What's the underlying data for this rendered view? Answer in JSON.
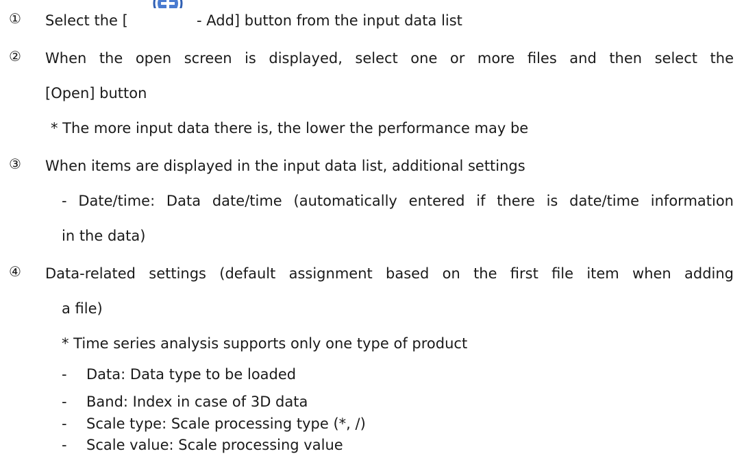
{
  "steps": [
    {
      "number": "①",
      "text_before_icon": "Select the [",
      "icon": "add-circle-icon",
      "text_after_icon": "- Add] button from the input data list"
    },
    {
      "number": "②",
      "line1": "When the open screen is displayed, select one or more files and then select the",
      "line2": "[Open] button",
      "note": "* The more input data there is, the lower the performance may be"
    },
    {
      "number": "③",
      "line1": "When items are displayed in the input data list, additional settings",
      "sub_line1": "- Date/time: Data date/time (automatically entered if there is date/time information",
      "sub_line2": "in the data)"
    },
    {
      "number": "④",
      "line1": "Data-related settings (default assignment based on the first file item when adding",
      "line2": "a file)",
      "note": "* Time series analysis supports only one type of product",
      "items": [
        {
          "dash": "-",
          "text": "Data: Data type to be loaded"
        },
        {
          "dash": "-",
          "text": "Band: Index in case of 3D data"
        },
        {
          "dash": "-",
          "text": "Scale type: Scale processing type (*, /)"
        },
        {
          "dash": "-",
          "text": "Scale value: Scale processing value"
        }
      ]
    }
  ],
  "colors": {
    "text": "#1a1a1a",
    "icon_blue": "#4a7bd0",
    "icon_border": "#2f5fb3"
  }
}
